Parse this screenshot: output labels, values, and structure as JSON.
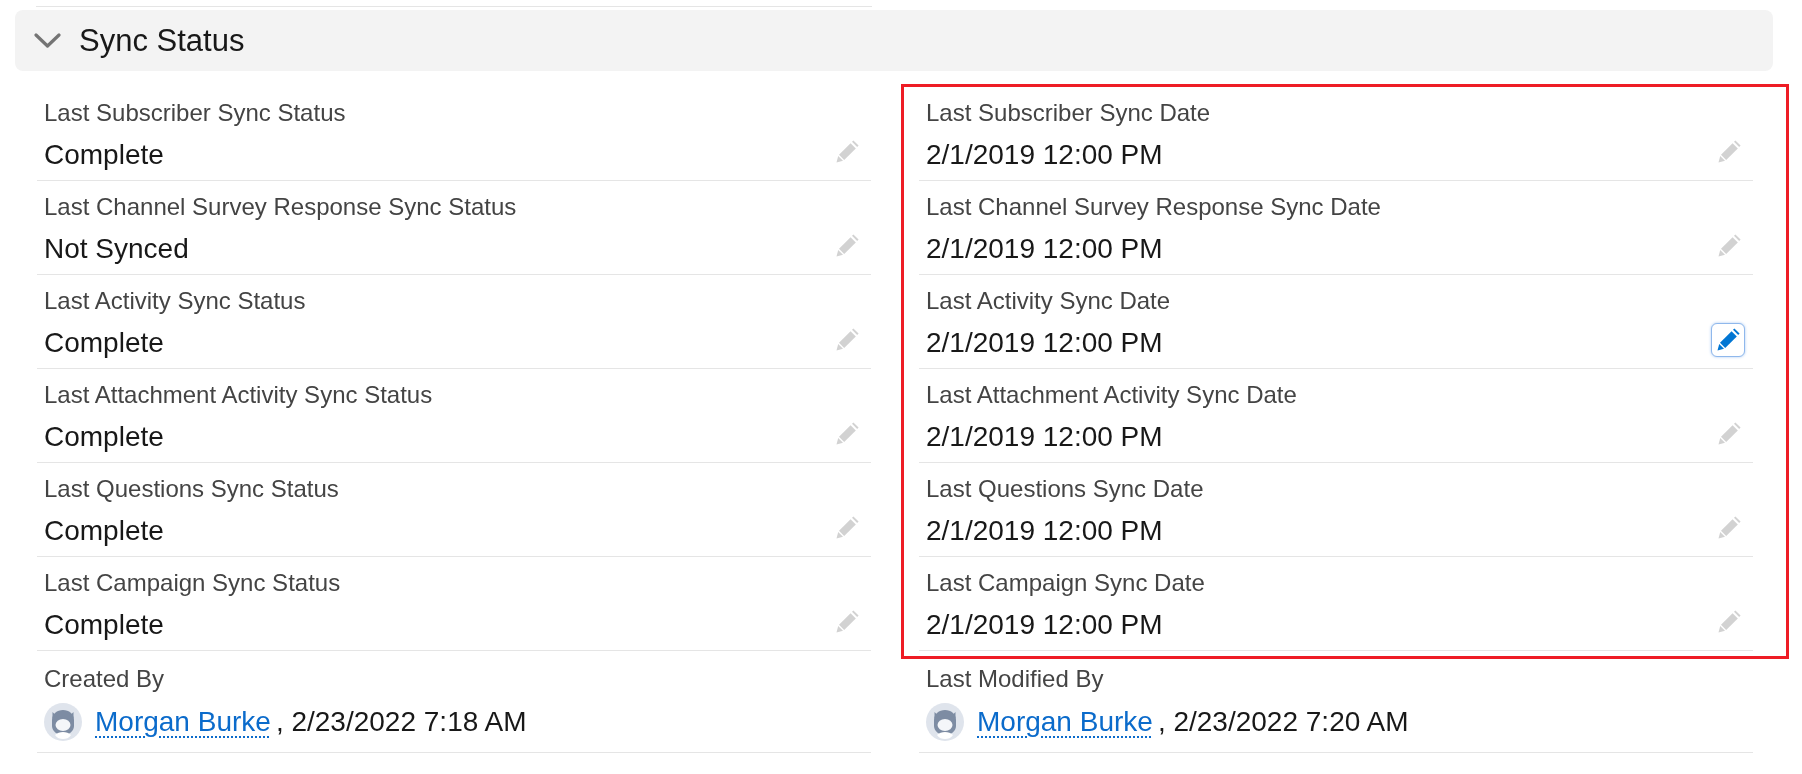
{
  "section": {
    "title": "Sync Status",
    "expanded": true
  },
  "columns": [
    {
      "highlighted": false,
      "fields": [
        {
          "label": "Last Subscriber Sync Status",
          "value": "Complete",
          "editable": true,
          "focused": false
        },
        {
          "label": "Last Channel Survey Response Sync Status",
          "value": "Not Synced",
          "editable": true,
          "focused": false
        },
        {
          "label": "Last Activity Sync Status",
          "value": "Complete",
          "editable": true,
          "focused": false
        },
        {
          "label": "Last Attachment Activity Sync Status",
          "value": "Complete",
          "editable": true,
          "focused": false
        },
        {
          "label": "Last Questions Sync Status",
          "value": "Complete",
          "editable": true,
          "focused": false
        },
        {
          "label": "Last Campaign Sync Status",
          "value": "Complete",
          "editable": true,
          "focused": false
        }
      ]
    },
    {
      "highlighted": true,
      "fields": [
        {
          "label": "Last Subscriber Sync Date",
          "value": "2/1/2019 12:00 PM",
          "editable": true,
          "focused": false
        },
        {
          "label": "Last Channel Survey Response Sync Date",
          "value": "2/1/2019 12:00 PM",
          "editable": true,
          "focused": false
        },
        {
          "label": "Last Activity Sync Date",
          "value": "2/1/2019 12:00 PM",
          "editable": true,
          "focused": true
        },
        {
          "label": "Last Attachment Activity Sync Date",
          "value": "2/1/2019 12:00 PM",
          "editable": true,
          "focused": false
        },
        {
          "label": "Last Questions Sync Date",
          "value": "2/1/2019 12:00 PM",
          "editable": true,
          "focused": false
        },
        {
          "label": "Last Campaign Sync Date",
          "value": "2/1/2019 12:00 PM",
          "editable": true,
          "focused": false
        }
      ]
    }
  ],
  "system_fields": [
    {
      "label": "Created By",
      "user": "Morgan Burke",
      "suffix": ", 2/23/2022 7:18 AM"
    },
    {
      "label": "Last Modified By",
      "user": "Morgan Burke",
      "suffix": ", 2/23/2022 7:20 AM"
    }
  ]
}
